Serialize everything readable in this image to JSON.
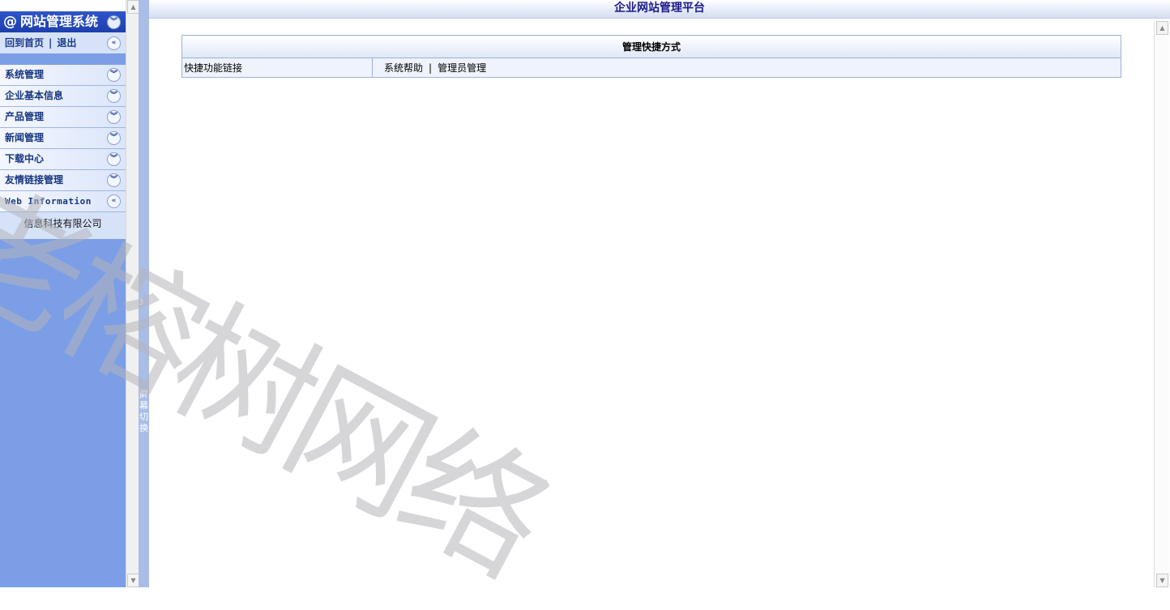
{
  "sidebar": {
    "title": "网站管理系统",
    "title_prefix": "@",
    "home_link": "回到首页",
    "link_separator": "|",
    "logout_link": "退出",
    "items": [
      {
        "label": "系统管理"
      },
      {
        "label": "企业基本信息"
      },
      {
        "label": "产品管理"
      },
      {
        "label": "新闻管理"
      },
      {
        "label": "下载中心"
      },
      {
        "label": "友情链接管理"
      },
      {
        "label": "Web Information"
      }
    ],
    "company": "信息科技有限公司"
  },
  "splitter": {
    "number": "3",
    "label": "屏幕切换"
  },
  "main": {
    "title": "企业网站管理平台",
    "table": {
      "header": "管理快捷方式",
      "row_label": "快捷功能链接",
      "links": [
        "系统帮助",
        "管理员管理"
      ],
      "separator": "|"
    }
  },
  "watermark": "老榕树网络",
  "colors": {
    "sidebar_bg": "#7b9ee6",
    "title_bar": "#1c3fae",
    "header_text": "#1a1a8c"
  },
  "icons": {
    "expand": "chevron-double-down-icon",
    "collapse": "chevron-double-left-icon"
  }
}
